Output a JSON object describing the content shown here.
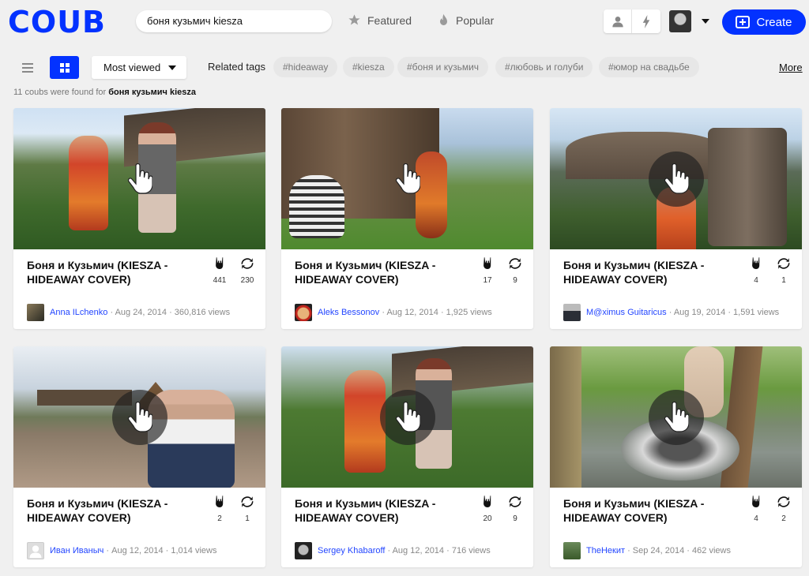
{
  "header": {
    "logo": "COUB",
    "search_value": "боня кузьмич kiesza",
    "nav": [
      {
        "label": "Featured",
        "icon": "star-icon"
      },
      {
        "label": "Popular",
        "icon": "flame-icon"
      }
    ],
    "create_label": "Create"
  },
  "toolbar": {
    "sort_value": "Most viewed",
    "related_label": "Related tags",
    "tags": [
      "#hideaway",
      "#kiesza",
      "#боня и кузьмич",
      "#любовь и голуби",
      "#юмор на свадьбе"
    ],
    "more_label": "More"
  },
  "results": {
    "prefix": "11 coubs were found for",
    "query": "боня кузьмич kiesza"
  },
  "cards": [
    {
      "title": "Боня и Кузьмич (KIESZA - HIDEAWAY COVER)",
      "likes": "441",
      "recoubs": "230",
      "author": "Anna ILchenko",
      "date": "· Aug 24, 2014 ·",
      "views": "360,816 views"
    },
    {
      "title": "Боня и Кузьмич (KIESZA - HIDEAWAY COVER)",
      "likes": "17",
      "recoubs": "9",
      "author": "Aleks Bessonov",
      "date": "· Aug 12, 2014 ·",
      "views": "1,925 views"
    },
    {
      "title": "Боня и Кузьмич (KIESZA - HIDEAWAY COVER)",
      "likes": "4",
      "recoubs": "1",
      "author": "M@ximus Guitaricus",
      "date": "· Aug 19, 2014 ·",
      "views": "1,591 views"
    },
    {
      "title": "Боня и Кузьмич (KIESZA - HIDEAWAY COVER)",
      "likes": "2",
      "recoubs": "1",
      "author": "Иван Иваныч",
      "date": "· Aug 12, 2014 ·",
      "views": "1,014 views"
    },
    {
      "title": "Боня и Кузьмич (KIESZA - HIDEAWAY COVER)",
      "likes": "20",
      "recoubs": "9",
      "author": "Sergey Khabaroff",
      "date": "· Aug 12, 2014 ·",
      "views": "716 views"
    },
    {
      "title": "Боня и Кузьмич (KIESZA - HIDEAWAY COVER)",
      "likes": "4",
      "recoubs": "2",
      "author": "TheНекит",
      "date": "· Sep 24, 2014 ·",
      "views": "462 views"
    }
  ],
  "colors": {
    "accent": "#0332ff",
    "author_link": "#2346ff",
    "background": "#f0f0f0"
  }
}
